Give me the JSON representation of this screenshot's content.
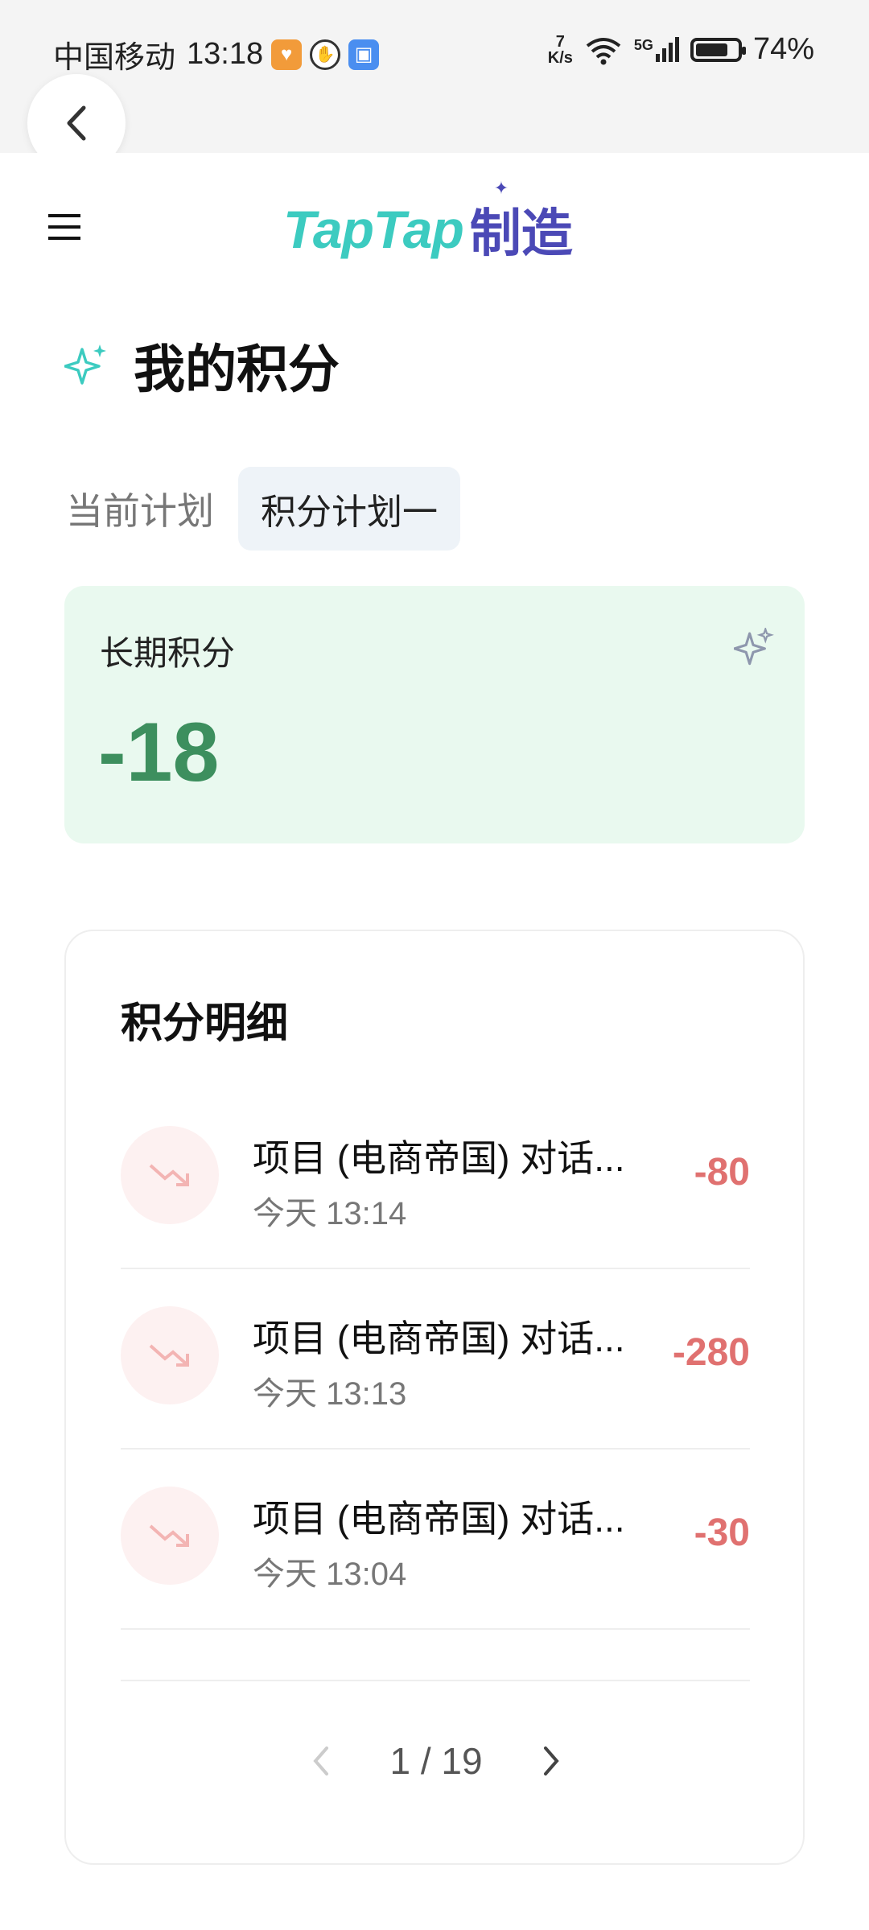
{
  "status_bar": {
    "carrier": "中国移动",
    "time": "13:18",
    "net_speed_value": "7",
    "net_speed_unit": "K/s",
    "signal_label": "5G",
    "battery": "74%"
  },
  "header": {
    "logo_text": "TapTap",
    "logo_text_cn": "制造"
  },
  "page": {
    "title": "我的积分"
  },
  "plan": {
    "label": "当前计划",
    "selected": "积分计划一"
  },
  "score_card": {
    "label": "长期积分",
    "value": "-18"
  },
  "details": {
    "title": "积分明细",
    "items": [
      {
        "title": "项目 (电商帝国) 对话...",
        "time": "今天 13:14",
        "amount": "-80"
      },
      {
        "title": "项目 (电商帝国) 对话...",
        "time": "今天 13:13",
        "amount": "-280"
      },
      {
        "title": "项目 (电商帝国) 对话...",
        "time": "今天 13:04",
        "amount": "-30"
      }
    ],
    "pagination": "1 / 19"
  },
  "colors": {
    "accent_teal": "#3ccbc0",
    "brand_purple": "#4b49b6",
    "score_green": "#3d8f5e",
    "card_green_bg": "#e9f9ef",
    "negative_red": "#e07170"
  }
}
